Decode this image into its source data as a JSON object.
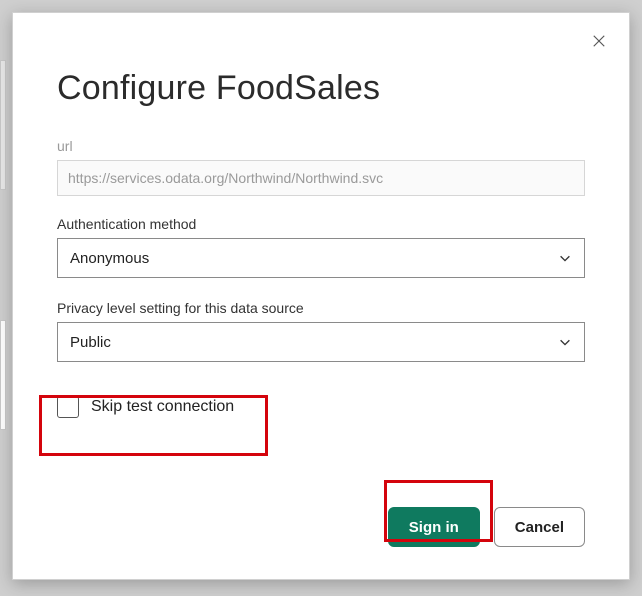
{
  "title": "Configure FoodSales",
  "url": {
    "label": "url",
    "value": "https://services.odata.org/Northwind/Northwind.svc"
  },
  "auth": {
    "label": "Authentication method",
    "value": "Anonymous"
  },
  "privacy": {
    "label": "Privacy level setting for this data source",
    "value": "Public"
  },
  "checkbox": {
    "label": "Skip test connection"
  },
  "buttons": {
    "signin": "Sign in",
    "cancel": "Cancel"
  }
}
